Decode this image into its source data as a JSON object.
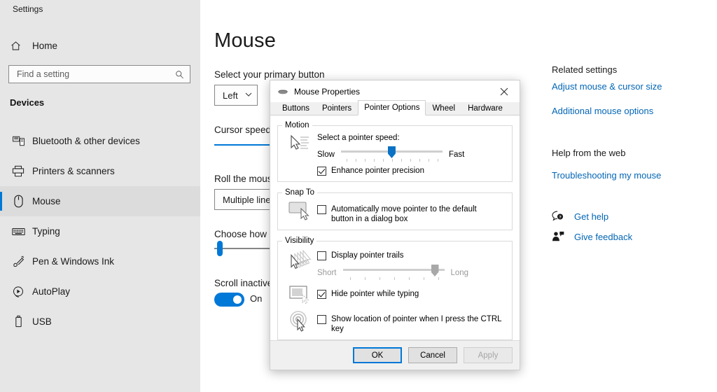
{
  "window": {
    "app_title": "Settings",
    "controls": {
      "minimize": "─",
      "maximize": "☐",
      "close": "✕"
    }
  },
  "sidebar": {
    "home_label": "Home",
    "search": {
      "placeholder": "Find a setting",
      "value": "",
      "icon": "search-icon"
    },
    "group_title": "Devices",
    "items": [
      {
        "label": "Bluetooth & other devices",
        "icon": "bluetooth-devices-icon",
        "selected": false
      },
      {
        "label": "Printers & scanners",
        "icon": "printer-icon",
        "selected": false
      },
      {
        "label": "Mouse",
        "icon": "mouse-icon",
        "selected": true
      },
      {
        "label": "Typing",
        "icon": "keyboard-icon",
        "selected": false
      },
      {
        "label": "Pen & Windows Ink",
        "icon": "pen-icon",
        "selected": false
      },
      {
        "label": "AutoPlay",
        "icon": "autoplay-icon",
        "selected": false
      },
      {
        "label": "USB",
        "icon": "usb-icon",
        "selected": false
      }
    ]
  },
  "main": {
    "page_title": "Mouse",
    "primary_button": {
      "label": "Select your primary button",
      "value": "Left",
      "chevron": "⌄"
    },
    "cursor_speed": {
      "label": "Cursor speed",
      "percent": 50
    },
    "scroll_wheel": {
      "label": "Roll the mous",
      "value": "Multiple line"
    },
    "lines_to_scroll": {
      "label": "Choose how m",
      "percent": 6
    },
    "scroll_inactive": {
      "label": "Scroll inactive",
      "state": "On"
    }
  },
  "rail": {
    "related_heading": "Related settings",
    "related_links": [
      "Adjust mouse & cursor size",
      "Additional mouse options"
    ],
    "help_heading": "Help from the web",
    "help_links": [
      "Troubleshooting my mouse"
    ],
    "actions": [
      {
        "label": "Get help",
        "icon": "help-question-icon"
      },
      {
        "label": "Give feedback",
        "icon": "feedback-person-icon"
      }
    ]
  },
  "dialog": {
    "title": "Mouse Properties",
    "title_icon": "mouse-icon",
    "close_glyph": "✕",
    "tabs": [
      {
        "label": "Buttons",
        "active": false
      },
      {
        "label": "Pointers",
        "active": false
      },
      {
        "label": "Pointer Options",
        "active": true
      },
      {
        "label": "Wheel",
        "active": false
      },
      {
        "label": "Hardware",
        "active": false
      }
    ],
    "motion": {
      "legend": "Motion",
      "icon": "pointer-speed-icon",
      "speed_label": "Select a pointer speed:",
      "slow_label": "Slow",
      "fast_label": "Fast",
      "slider_percent": 50,
      "tick_count": 11,
      "enhance_precision": {
        "label": "Enhance pointer precision",
        "checked": true
      }
    },
    "snap_to": {
      "legend": "Snap To",
      "icon": "snap-to-button-icon",
      "auto_move": {
        "label": "Automatically move pointer to the default button in a dialog box",
        "checked": false
      }
    },
    "visibility": {
      "legend": "Visibility",
      "trails": {
        "label": "Display pointer trails",
        "checked": false,
        "icon": "pointer-trails-icon"
      },
      "trails_short_label": "Short",
      "trails_long_label": "Long",
      "trails_slider_percent": 83,
      "trails_tick_count": 7,
      "hide_while_typing": {
        "label": "Hide pointer while typing",
        "checked": true,
        "icon": "hide-pointer-typing-icon"
      },
      "show_location": {
        "label": "Show location of pointer when I press the CTRL key",
        "checked": false,
        "icon": "locate-pointer-icon"
      }
    },
    "buttons": {
      "ok": "OK",
      "cancel": "Cancel",
      "apply": "Apply"
    }
  },
  "colors": {
    "accent": "#0078d7",
    "link": "#0366b5",
    "sidebar_bg": "#e6e6e6",
    "dialog_bg": "#f0f0f0"
  }
}
